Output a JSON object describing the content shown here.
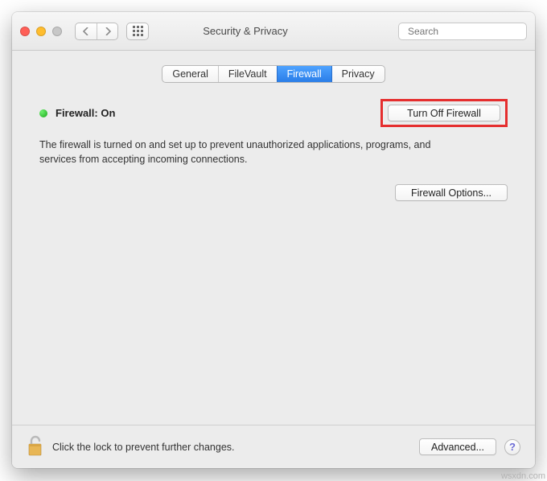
{
  "window": {
    "title": "Security & Privacy"
  },
  "search": {
    "placeholder": "Search",
    "value": ""
  },
  "tabs": {
    "general": "General",
    "filevault": "FileVault",
    "firewall": "Firewall",
    "privacy": "Privacy"
  },
  "firewall": {
    "status_label": "Firewall: On",
    "turn_off_button": "Turn Off Firewall",
    "description": "The firewall is turned on and set up to prevent unauthorized applications, programs, and services from accepting incoming connections.",
    "options_button": "Firewall Options..."
  },
  "footer": {
    "lock_text": "Click the lock to prevent further changes.",
    "advanced_button": "Advanced...",
    "help": "?"
  },
  "watermark": "wsxdn.com"
}
